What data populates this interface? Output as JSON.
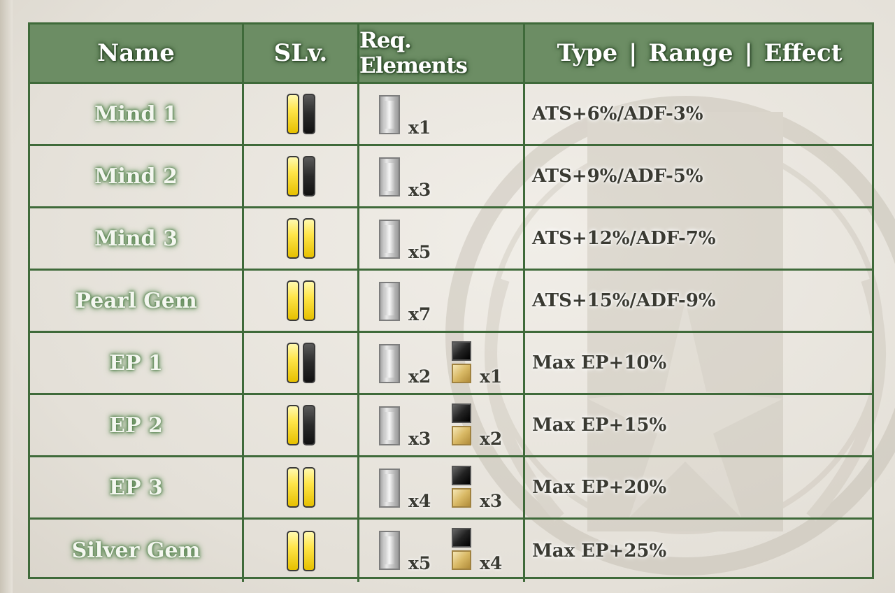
{
  "header": {
    "name": "Name",
    "slv": "SLv.",
    "req": "Req. Elements",
    "effect": "Type | Range | Effect"
  },
  "rows": [
    {
      "name": "Mind 1",
      "slv": [
        1,
        0
      ],
      "silver": "x1",
      "black": "",
      "effect": "ATS+6%/ADF-3%"
    },
    {
      "name": "Mind 2",
      "slv": [
        1,
        0
      ],
      "silver": "x3",
      "black": "",
      "effect": "ATS+9%/ADF-5%"
    },
    {
      "name": "Mind 3",
      "slv": [
        1,
        1
      ],
      "silver": "x5",
      "black": "",
      "effect": "ATS+12%/ADF-7%"
    },
    {
      "name": "Pearl Gem",
      "slv": [
        1,
        1
      ],
      "silver": "x7",
      "black": "",
      "effect": "ATS+15%/ADF-9%"
    },
    {
      "name": "EP 1",
      "slv": [
        1,
        0
      ],
      "silver": "x2",
      "black": "x1",
      "effect": "Max EP+10%"
    },
    {
      "name": "EP 2",
      "slv": [
        1,
        0
      ],
      "silver": "x3",
      "black": "x2",
      "effect": "Max EP+15%"
    },
    {
      "name": "EP 3",
      "slv": [
        1,
        1
      ],
      "silver": "x4",
      "black": "x3",
      "effect": "Max EP+20%"
    },
    {
      "name": "Silver Gem",
      "slv": [
        1,
        1
      ],
      "silver": "x5",
      "black": "x4",
      "effect": "Max EP+25%"
    }
  ],
  "colors": {
    "border": "#3f6a3a",
    "header_bg": "#6c8d64",
    "gauge_filled": "#ffe54a",
    "gauge_empty": "#2a2a2a"
  }
}
